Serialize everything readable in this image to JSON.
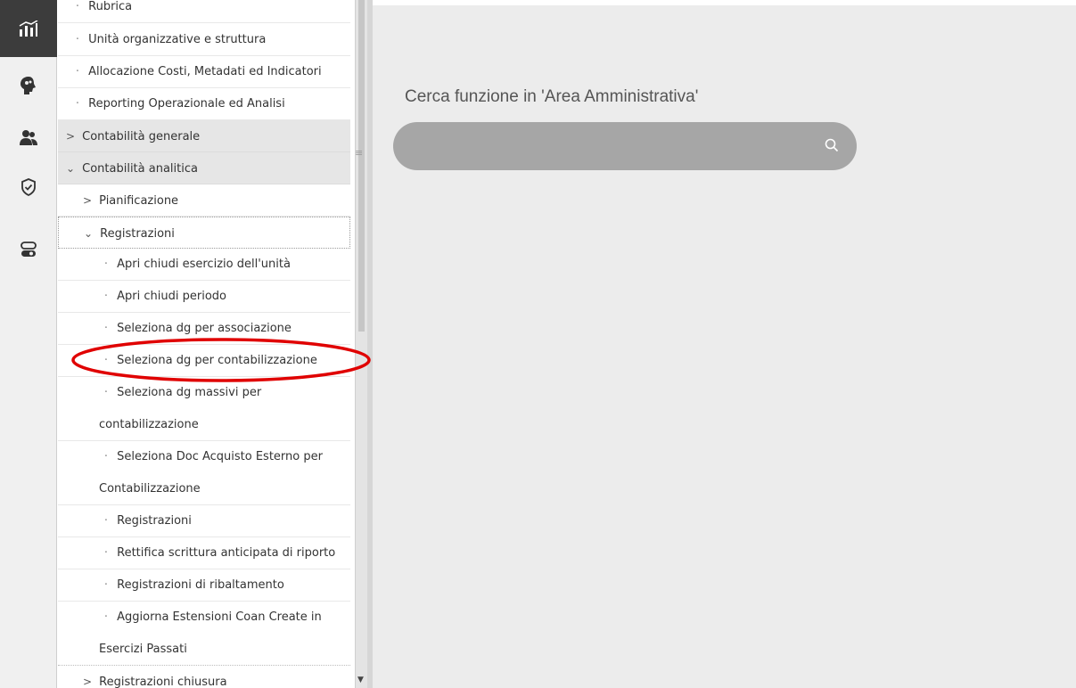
{
  "rail": {
    "items": [
      {
        "icon": "chart-icon",
        "active": true
      },
      {
        "icon": "brain-icon",
        "active": false
      },
      {
        "icon": "users-icon",
        "active": false
      },
      {
        "icon": "shield-check-icon",
        "active": false
      },
      {
        "icon": "toggle-icon",
        "active": false
      }
    ]
  },
  "menu": {
    "items": [
      {
        "label": "Rubrica"
      },
      {
        "label": "Unità organizzative e struttura"
      },
      {
        "label": "Allocazione Costi, Metadati ed Indicatori"
      },
      {
        "label": "Reporting Operazionale ed Analisi"
      },
      {
        "label": "Contabilità generale",
        "chevron": ">"
      },
      {
        "label": "Contabilità analitica",
        "chevron": "⌄"
      },
      {
        "label": "Pianificazione",
        "chevron": ">"
      },
      {
        "label": "Registrazioni",
        "chevron": "⌄"
      },
      {
        "label": "Apri chiudi esercizio dell'unità"
      },
      {
        "label": "Apri chiudi periodo"
      },
      {
        "label": "Seleziona dg per associazione"
      },
      {
        "label": "Seleziona dg per contabilizzazione"
      },
      {
        "label": "Seleziona dg massivi per",
        "continuation": "contabilizzazione"
      },
      {
        "label": "Seleziona Doc Acquisto Esterno per",
        "continuation": "Contabilizzazione"
      },
      {
        "label": "Registrazioni"
      },
      {
        "label": "Rettifica scrittura anticipata di riporto"
      },
      {
        "label": "Registrazioni di ribaltamento"
      },
      {
        "label": "Aggiorna Estensioni Coan Create in",
        "continuation": "Esercizi Passati"
      },
      {
        "label": "Registrazioni chiusura",
        "chevron": ">"
      }
    ],
    "bullet": "·"
  },
  "search": {
    "label": "Cerca funzione in 'Area Amministrativa'",
    "value": "",
    "placeholder": ""
  },
  "colors": {
    "highlight": "#e00000",
    "search_bg": "#a6a6a6",
    "main_bg": "#ececec"
  }
}
